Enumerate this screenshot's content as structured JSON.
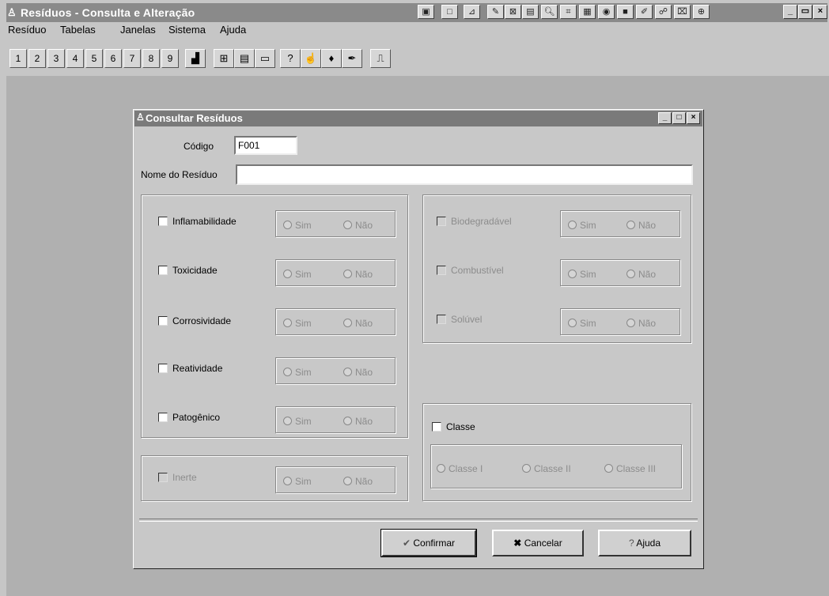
{
  "window": {
    "title": "Resíduos - Consulta e Alteração",
    "icon": "app-icon"
  },
  "menu": [
    {
      "label": "Resíduo"
    },
    {
      "label": "Tabelas"
    },
    {
      "label": "Janelas"
    },
    {
      "label": "Sistema"
    },
    {
      "label": "Ajuda"
    }
  ],
  "toolbar": {
    "numbers": [
      "1",
      "2",
      "3",
      "4",
      "5",
      "6",
      "7",
      "8",
      "9"
    ],
    "tools": [
      "bar-chart-icon",
      "table-icon",
      "form-icon",
      "window-icon",
      "help-icon",
      "hand-pointer-icon",
      "pin-icon",
      "pen-icon",
      "exit-door-icon"
    ]
  },
  "dialog": {
    "title": "Consultar Resíduos",
    "codigo_label": "Código",
    "codigo_value": "F001",
    "nome_label": "Nome do Resíduo",
    "nome_value": "",
    "left_props": [
      {
        "label": "Inflamabilidade",
        "enabled": true
      },
      {
        "label": "Toxicidade",
        "enabled": true
      },
      {
        "label": "Corrosividade",
        "enabled": true
      },
      {
        "label": "Reatividade",
        "enabled": true
      },
      {
        "label": "Patogênico",
        "enabled": true
      }
    ],
    "inerte": {
      "label": "Inerte",
      "enabled": false
    },
    "right_props": [
      {
        "label": "Biodegradável",
        "enabled": false
      },
      {
        "label": "Combustível",
        "enabled": false
      },
      {
        "label": "Solúvel",
        "enabled": false
      }
    ],
    "radio_sim": "Sim",
    "radio_nao": "Não",
    "classe": {
      "label": "Classe",
      "options": [
        "Classe I",
        "Classe II",
        "Classe III"
      ]
    },
    "buttons": {
      "confirm": "Confirmar",
      "cancel": "Cancelar",
      "help": "Ajuda"
    }
  }
}
